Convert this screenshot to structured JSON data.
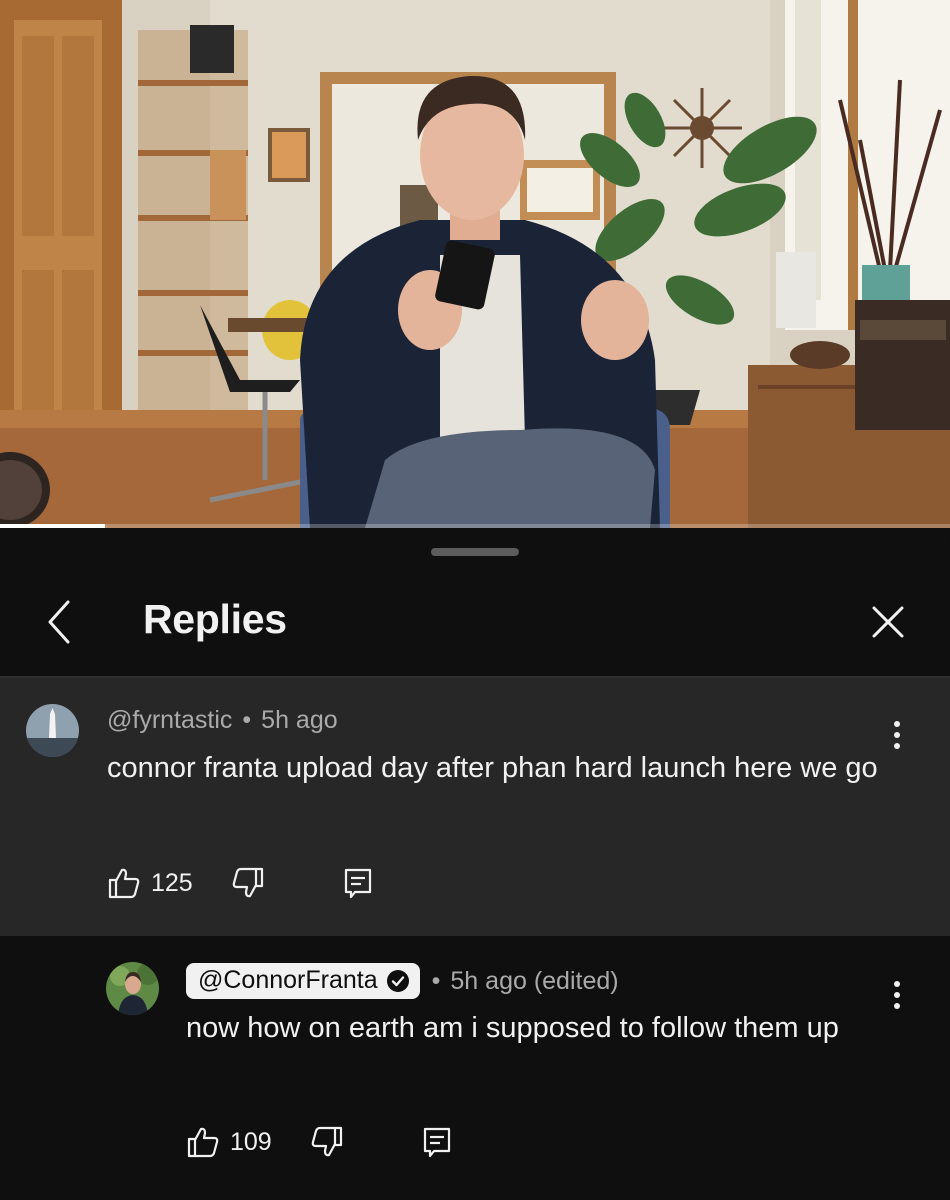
{
  "video": {
    "progress_fraction": 0.11
  },
  "sheet": {
    "title": "Replies"
  },
  "comments": [
    {
      "author": "@fyrntastic",
      "separator": "•",
      "time": "5h ago",
      "text": "connor franta upload day after phan hard launch here we go",
      "likes": "125",
      "verified": false
    },
    {
      "author": "@ConnorFranta",
      "separator": "•",
      "time": "5h ago (edited)",
      "text": "now how on earth am i supposed to follow them up",
      "likes": "109",
      "verified": true
    }
  ],
  "icons": {
    "back": "chevron-left-icon",
    "close": "close-icon",
    "more": "more-vertical-icon",
    "like": "thumbs-up-icon",
    "dislike": "thumbs-down-icon",
    "reply": "comment-reply-icon",
    "verified": "verified-check-icon"
  },
  "colors": {
    "sheet_bg": "#0f0f0f",
    "comment_highlight_bg": "#272727",
    "primary_text": "#f1f1f1",
    "secondary_text": "#aaaaaa"
  }
}
